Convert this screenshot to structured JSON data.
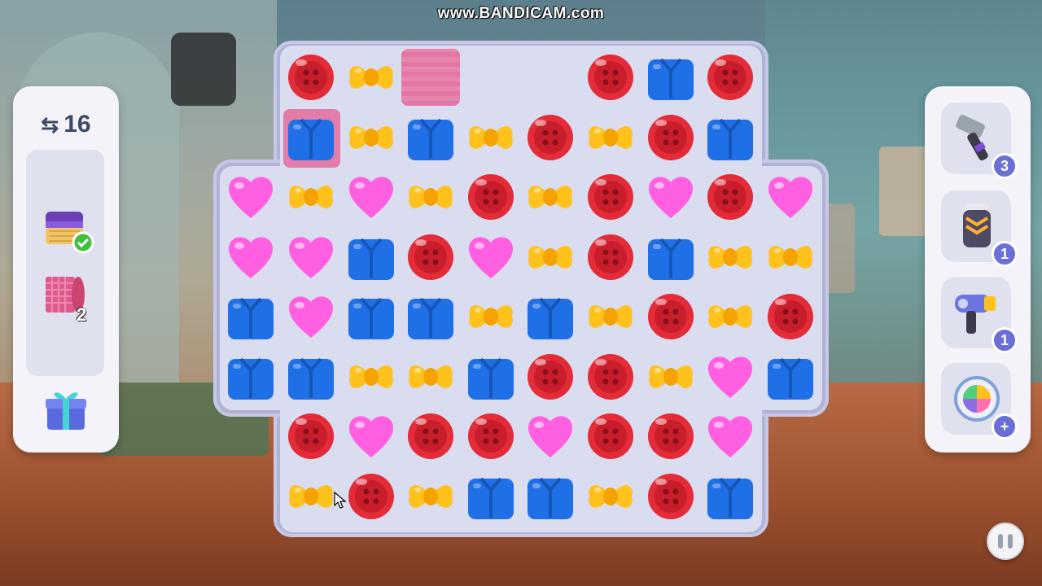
{
  "watermark": "www.BANDICAM.com",
  "moves": {
    "value": "16"
  },
  "goals": [
    {
      "name": "chest",
      "completed": true
    },
    {
      "name": "rug",
      "remaining": "2"
    }
  ],
  "boosters": [
    {
      "name": "hammer-icon",
      "count": "3"
    },
    {
      "name": "shaver-icon",
      "count": "1"
    },
    {
      "name": "hair-dryer-icon",
      "count": "1"
    },
    {
      "name": "shuffle-icon",
      "count": "+"
    }
  ],
  "colors": {
    "button": "#e42b38",
    "bow": "#ffc21d",
    "shirt": "#1f6fe6",
    "heart": "#ff5fe0",
    "board": "#dadcef",
    "panel": "#f4f3f9",
    "badge": "#6a6fd6"
  },
  "grid": [
    [
      null,
      "button",
      "bow",
      "rug",
      null,
      null,
      "button",
      "shirt",
      "button",
      null
    ],
    [
      null,
      "shirt",
      "bow",
      "shirt",
      "bow",
      "button",
      "bow",
      "button",
      "shirt",
      null
    ],
    [
      "heart",
      "bow",
      "heart",
      "bow",
      "button",
      "bow",
      "button",
      "heart",
      "button",
      "heart"
    ],
    [
      "heart",
      "heart",
      "shirt",
      "button",
      "heart",
      "bow",
      "button",
      "shirt",
      "bow",
      "bow"
    ],
    [
      "shirt",
      "heart",
      "shirt",
      "shirt",
      "bow",
      "shirt",
      "bow",
      "button",
      "bow",
      "button"
    ],
    [
      "shirt",
      "shirt",
      "bow",
      "bow",
      "shirt",
      "button",
      "button",
      "bow",
      "heart",
      "shirt"
    ],
    [
      null,
      "button",
      "heart",
      "button",
      "button",
      "heart",
      "button",
      "button",
      "heart",
      null
    ],
    [
      null,
      "bow",
      "button",
      "bow",
      "shirt",
      "shirt",
      "bow",
      "button",
      "shirt",
      null
    ]
  ]
}
